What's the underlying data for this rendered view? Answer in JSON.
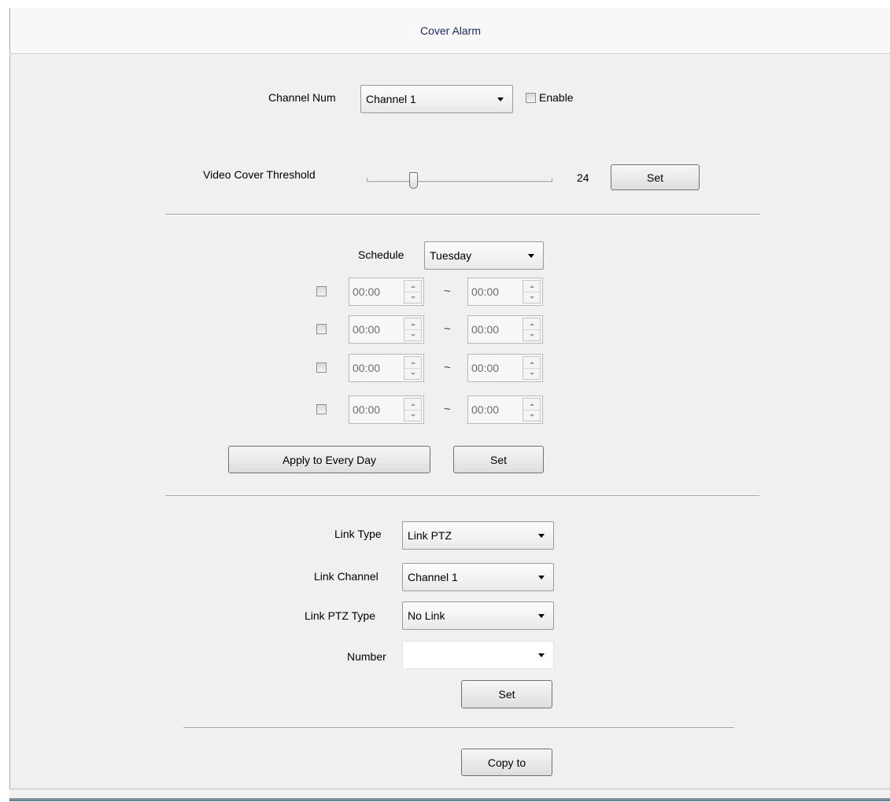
{
  "header": {
    "title": "Cover Alarm"
  },
  "channel": {
    "label": "Channel Num",
    "selected": "Channel  1",
    "enable_label": "Enable",
    "enabled": false
  },
  "threshold": {
    "label": "Video Cover Threshold",
    "value": "24",
    "set_label": "Set"
  },
  "schedule": {
    "label": "Schedule",
    "selected_day": "Tuesday",
    "separator": "~",
    "rows": [
      {
        "enabled": false,
        "start": "00:00",
        "end": "00:00"
      },
      {
        "enabled": false,
        "start": "00:00",
        "end": "00:00"
      },
      {
        "enabled": false,
        "start": "00:00",
        "end": "00:00"
      },
      {
        "enabled": false,
        "start": "00:00",
        "end": "00:00"
      }
    ],
    "apply_label": "Apply to Every Day",
    "set_label": "Set"
  },
  "link": {
    "type_label": "Link Type",
    "type_value": "Link PTZ",
    "channel_label": "Link Channel",
    "channel_value": "Channel  1",
    "ptz_type_label": "Link PTZ Type",
    "ptz_type_value": "No Link",
    "number_label": "Number",
    "number_value": "",
    "set_label": "Set"
  },
  "copy_label": "Copy to",
  "icons": [
    "dropdown-arrow-icon",
    "spin-up-icon",
    "spin-down-icon",
    "slider-thumb-icon"
  ]
}
